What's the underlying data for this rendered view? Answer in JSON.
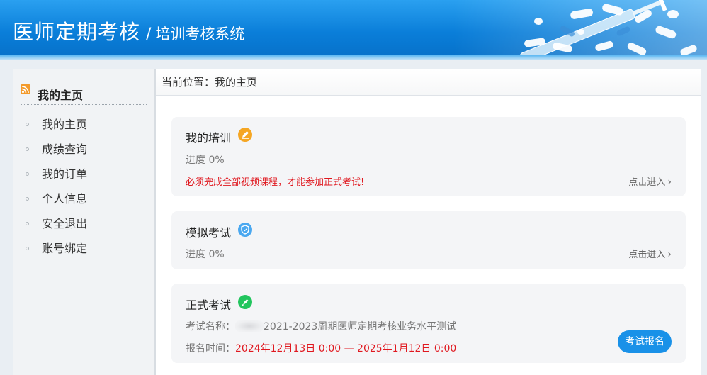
{
  "header": {
    "title": "医师定期考核",
    "separator": "/",
    "subtitle": "培训考核系统"
  },
  "sidebar": {
    "heading": "我的主页",
    "items": [
      {
        "label": "我的主页"
      },
      {
        "label": "成绩查询"
      },
      {
        "label": "我的订单"
      },
      {
        "label": "个人信息"
      },
      {
        "label": "安全退出"
      },
      {
        "label": "账号绑定"
      }
    ]
  },
  "breadcrumb": {
    "prefix": "当前位置：",
    "current": "我的主页"
  },
  "cards": {
    "training": {
      "title": "我的培训",
      "progress": "进度 0%",
      "warning": "必须完成全部视频课程，才能参加正式考试!",
      "enter": "点击进入",
      "icon": "pen-icon",
      "icon_color": "#f5a623"
    },
    "mock": {
      "title": "模拟考试",
      "progress": "进度 0%",
      "enter": "点击进入",
      "icon": "shield-icon",
      "icon_color": "#4aa8f0"
    },
    "formal": {
      "title": "正式考试",
      "exam_name_label": "考试名称：",
      "exam_name": "2021-2023周期医师定期考核业务水平测试",
      "signup_label": "报名时间：",
      "signup_time": "2024年12月13日 0:00 — 2025年1月12日 0:00",
      "button": "考试报名",
      "icon": "pen-tool-icon",
      "icon_color": "#22c55e"
    }
  },
  "colors": {
    "header_blue": "#0a7ed9",
    "warning_red": "#e0181f",
    "button_blue": "#1991e8"
  }
}
